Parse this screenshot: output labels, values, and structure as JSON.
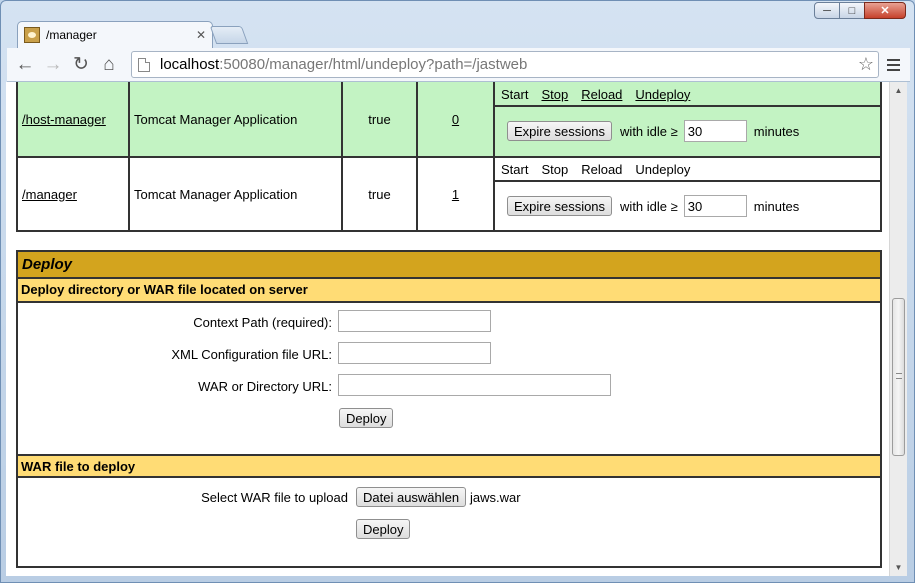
{
  "browser": {
    "tab_title": "/manager",
    "url_host": "localhost",
    "url_rest": ":50080/manager/html/undeploy?path=/jastweb"
  },
  "apps": [
    {
      "path": "/host-manager",
      "display_name": "Tomcat Manager Application",
      "running": "true",
      "sessions": "0",
      "commands": {
        "start": "Start",
        "stop": "Stop",
        "reload": "Reload",
        "undeploy": "Undeploy"
      },
      "expire_button": "Expire sessions",
      "with_idle": "with idle ≥",
      "idle_value": "30",
      "minutes": "minutes",
      "highlight_color": "#c3f3c3"
    },
    {
      "path": "/manager",
      "display_name": "Tomcat Manager Application",
      "running": "true",
      "sessions": "1",
      "commands": {
        "start": "Start",
        "stop": "Stop",
        "reload": "Reload",
        "undeploy": "Undeploy"
      },
      "expire_button": "Expire sessions",
      "with_idle": "with idle ≥",
      "idle_value": "30",
      "minutes": "minutes"
    }
  ],
  "deploy": {
    "title": "Deploy",
    "server_section": {
      "heading": "Deploy directory or WAR file located on server",
      "context_path_label": "Context Path (required):",
      "xml_config_label": "XML Configuration file URL:",
      "war_dir_label": "WAR or Directory URL:",
      "deploy_button": "Deploy"
    },
    "upload_section": {
      "heading": "WAR file to deploy",
      "select_label": "Select WAR file to upload",
      "choose_button": "Datei auswählen",
      "chosen_file": "jaws.war",
      "deploy_button": "Deploy"
    }
  },
  "colors": {
    "deploy_header": "#d3a41e",
    "subheading": "#ffdc75",
    "running_row": "#c3f3c3"
  }
}
